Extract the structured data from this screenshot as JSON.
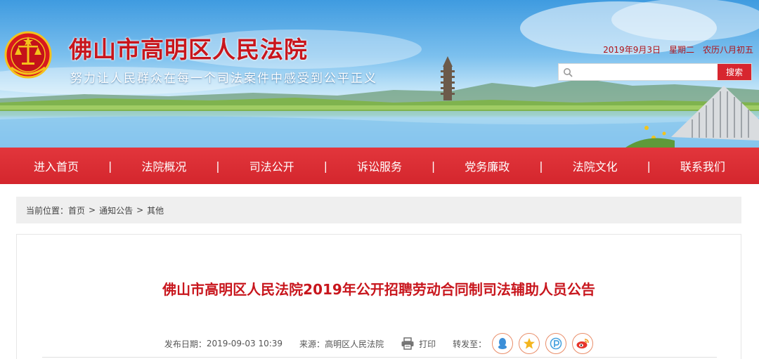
{
  "header": {
    "site_title": "佛山市高明区人民法院",
    "slogan": "努力让人民群众在每一个司法案件中感受到公平正义",
    "date": "2019年9月3日",
    "weekday": "星期二",
    "lunar_date": "农历八月初五",
    "search": {
      "value": "",
      "placeholder": "",
      "button_label": "搜索"
    }
  },
  "nav": {
    "items": [
      "进入首页",
      "法院概况",
      "司法公开",
      "诉讼服务",
      "党务廉政",
      "法院文化",
      "联系我们"
    ],
    "separator": "|"
  },
  "breadcrumb": {
    "prefix": "当前位置：",
    "items": [
      "首页",
      "通知公告",
      "其他"
    ],
    "separator": ">"
  },
  "article": {
    "title": "佛山市高明区人民法院2019年公开招聘劳动合同制司法辅助人员公告",
    "publish_label": "发布日期：",
    "publish_date": "2019-09-03 10:39",
    "source_label": "来源：",
    "source": "高明区人民法院",
    "print_label": "打印",
    "share_label": "转发至：",
    "share_icons": [
      "qq-icon",
      "qzone-star-icon",
      "pengyou-icon",
      "weibo-icon"
    ]
  },
  "colors": {
    "brand_red": "#c8161d",
    "nav_red": "#d7262f",
    "share_orange": "#e98d69",
    "qq_blue": "#3b8fd8",
    "qzone_yellow": "#f4b51e",
    "pengyou_blue": "#4aa3df",
    "weibo_red": "#e6352b"
  }
}
